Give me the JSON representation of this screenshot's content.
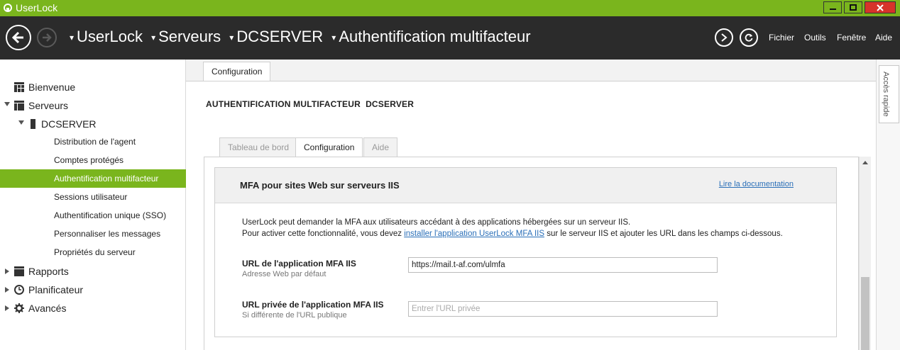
{
  "window": {
    "title": "UserLock",
    "accent": "#7ab51d",
    "navbar_bg": "#2b2b2b"
  },
  "breadcrumb": [
    "UserLock",
    "Serveurs",
    "DCSERVER",
    "Authentification multifacteur"
  ],
  "menu": [
    "Fichier",
    "Outils",
    "Fenêtre",
    "Aide"
  ],
  "sidebar": {
    "items": [
      {
        "label": "Bienvenue"
      },
      {
        "label": "Serveurs"
      },
      {
        "label": "DCSERVER"
      },
      {
        "label": "Distribution de l'agent"
      },
      {
        "label": "Comptes protégés"
      },
      {
        "label": "Authentification multifacteur"
      },
      {
        "label": "Sessions utilisateur"
      },
      {
        "label": "Authentification unique (SSO)"
      },
      {
        "label": "Personnaliser les messages"
      },
      {
        "label": "Propriétés du serveur"
      },
      {
        "label": "Rapports"
      },
      {
        "label": "Planificateur"
      },
      {
        "label": "Avancés"
      }
    ]
  },
  "main": {
    "top_tab": "Configuration",
    "page_title": "AUTHENTIFICATION MULTIFACTEUR  DCSERVER",
    "tabs": [
      {
        "label": "Tableau de bord"
      },
      {
        "label": "Configuration"
      },
      {
        "label": "Aide"
      }
    ],
    "panel": {
      "title": "MFA pour sites Web sur serveurs IIS",
      "doc_link": "Lire la documentation",
      "desc_line1": "UserLock peut demander la MFA aux utilisateurs accédant à des applications hébergées sur un serveur IIS.",
      "desc_line2_pre": "Pour activer cette fonctionnalité, vous devez ",
      "desc_line2_link": "installer l'application UserLock MFA IIS",
      "desc_line2_post": " sur le serveur IIS et ajouter les URL dans les champs ci-dessous.",
      "fields": [
        {
          "label": "URL de l'application MFA IIS",
          "sublabel": "Adresse Web par défaut",
          "value": "https://mail.t-af.com/ulmfa",
          "placeholder": ""
        },
        {
          "label": "URL privée de l'application MFA IIS",
          "sublabel": "Si différente de l'URL publique",
          "value": "",
          "placeholder": "Entrer l'URL privée"
        }
      ]
    }
  },
  "quick_access": "Accès rapide"
}
